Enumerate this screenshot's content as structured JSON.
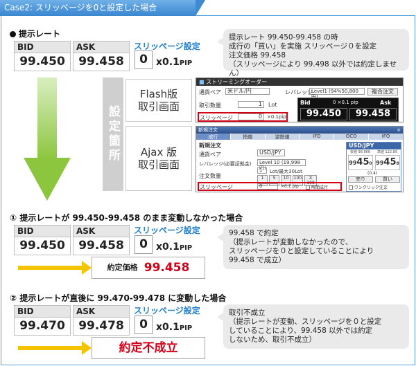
{
  "header": {
    "title": "Case2: スリッページを0と設定した場合"
  },
  "intro": {
    "heading": "提示レート",
    "bid_label": "BID",
    "bid_value": "99.450",
    "ask_label": "ASK",
    "ask_value": "99.458",
    "slip_label": "スリッページ設定",
    "slip_value": "0",
    "slip_unit": "x0.1",
    "slip_unit_small": "PIP",
    "note_lines": [
      "提示レート 99.450-99.458 の時",
      "成行の「買い」を実施 スリッページ０を設定",
      "注文価格 99.458",
      "（スリッページにより 99.498 以外では約定しません）"
    ]
  },
  "settings": {
    "vertical_label": "設定箇所",
    "flash_title_1": "Flash版",
    "flash_title_2": "取引画面",
    "ajax_title_1": "Ajax 版",
    "ajax_title_2": "取引画面"
  },
  "flash_window": {
    "title": "ストリーミングオーダー",
    "pair_label": "通貨ペア",
    "pair_value": "米ドル/円",
    "leverage_label": "レバレッジ",
    "leverage_value": "Level1 (94%50,800円)",
    "compound_button": "複合注文",
    "qty_label": "取引数量",
    "qty_value": "1",
    "qty_unit": "Lot",
    "slip_label": "スリッページ",
    "slip_value": "0",
    "slip_unit": "×0.1pip",
    "bid_label": "Bid",
    "ask_label": "Ask",
    "spread": "0 ×0.1 pip",
    "bid_value": "99.450",
    "ask_value": "99.458"
  },
  "ajax_window": {
    "title": "新規注文",
    "tabs": [
      "成行",
      "指値",
      "逆指値",
      "IFD",
      "OCO",
      "IFO"
    ],
    "section": "新規注文",
    "pair_label": "通貨ペア",
    "pair_value": "USD/JPY",
    "leverage_label": "レバレッジ(必要証拠金)",
    "leverage_value": "Level 10 (19,998円)",
    "qty_label": "注文数量",
    "qty_value": "1",
    "qty_hint": "Lot/最大30Lot",
    "qty_buttons": [
      "1",
      "5",
      "10",
      "100",
      "X 100"
    ],
    "slip_label": "スリッページ",
    "slip_value": "0",
    "slip_unit": "×0.1 pip",
    "time_label": "時間成行",
    "quote_pair": "USD/JPY",
    "quote_sub1": "安値 98.866",
    "quote_sub2": "高値 122.89",
    "bid_big": "99",
    "bid_small": "45",
    "bid_last": "0",
    "ask_big": "99",
    "ask_small": "45",
    "ask_last": "8",
    "spread": "(0.4)",
    "sell": "売り",
    "buy": "買い",
    "oneclick": "ワンクリック注文"
  },
  "case1": {
    "heading": "① 提示レートが 99.450-99.458 のまま変動しなかった場合",
    "bid_label": "BID",
    "bid_value": "99.450",
    "ask_label": "ASK",
    "ask_value": "99.458",
    "slip_label": "スリッページ設定",
    "slip_value": "0",
    "slip_unit": "x0.1",
    "slip_unit_small": "PIP",
    "result_label": "約定価格",
    "result_value": "99.458",
    "note_lines": [
      "99.458 で約定",
      "（提示レートが変動しなかったので、",
      "スリッページを０と設定していることにより",
      "99.458 で成立）"
    ]
  },
  "case2": {
    "heading": "② 提示レートが直後に 99.470-99.478 に変動した場合",
    "bid_label": "BID",
    "bid_value": "99.470",
    "ask_label": "ASK",
    "ask_value": "99.478",
    "slip_label": "スリッページ設定",
    "slip_value": "0",
    "slip_unit": "x0.1",
    "slip_unit_small": "PIP",
    "result_text": "約定不成立",
    "note_lines": [
      "取引不成立",
      "（提示レートが変動、スリッページを０と設定",
      "していることにより、99.458 以外では約定",
      "しないため、取引不成立）"
    ]
  },
  "colors": {
    "accent_blue": "#1e7fd0",
    "arrow_green": "#8cc63f",
    "arrow_yellow": "#f5c400",
    "result_red": "#d4001a"
  }
}
